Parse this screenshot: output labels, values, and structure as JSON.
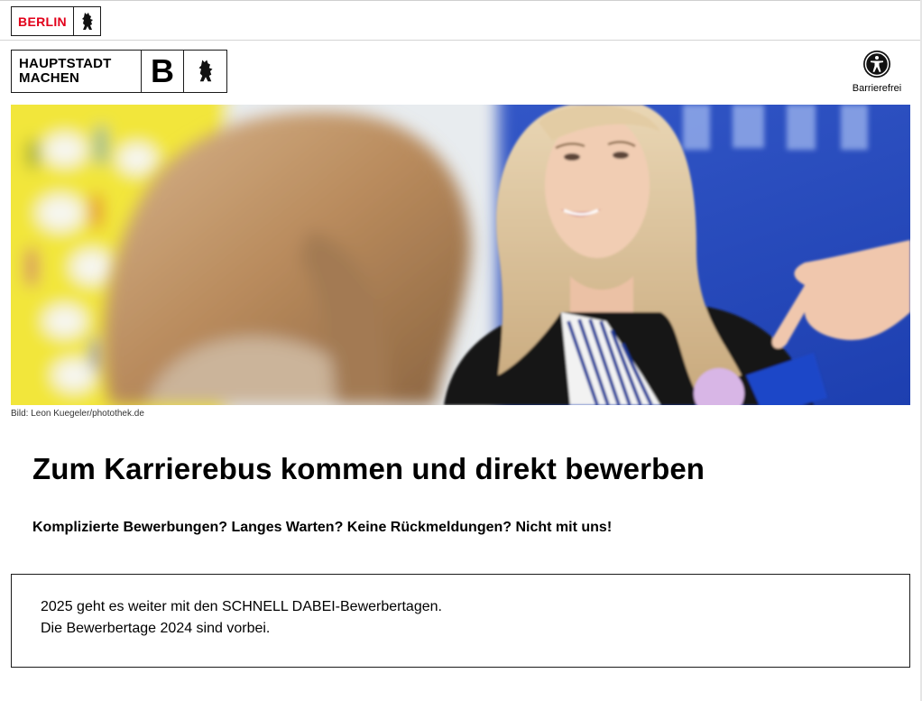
{
  "topbar": {
    "berlin_logo_text": "BERLIN"
  },
  "header": {
    "logo_line1": "HAUPTSTADT",
    "logo_line2": "MACHEN",
    "logo_letter": "B",
    "accessibility_label": "Barrierefrei"
  },
  "hero": {
    "credit": "Bild: Leon Kuegeler/photothek.de"
  },
  "main": {
    "title": "Zum Karrierebus kommen und direkt bewerben",
    "subtitle": "Komplizierte Bewerbungen? Langes Warten? Keine Rückmeldungen? Nicht mit uns!",
    "info_line1": "2025 geht es weiter mit den SCHNELL DABEI-Bewerbertagen.",
    "info_line2": "Die Bewerbertage 2024 sind vorbei."
  },
  "colors": {
    "berlin_red": "#e2001a",
    "text": "#000000",
    "border": "#1a1a1a"
  }
}
